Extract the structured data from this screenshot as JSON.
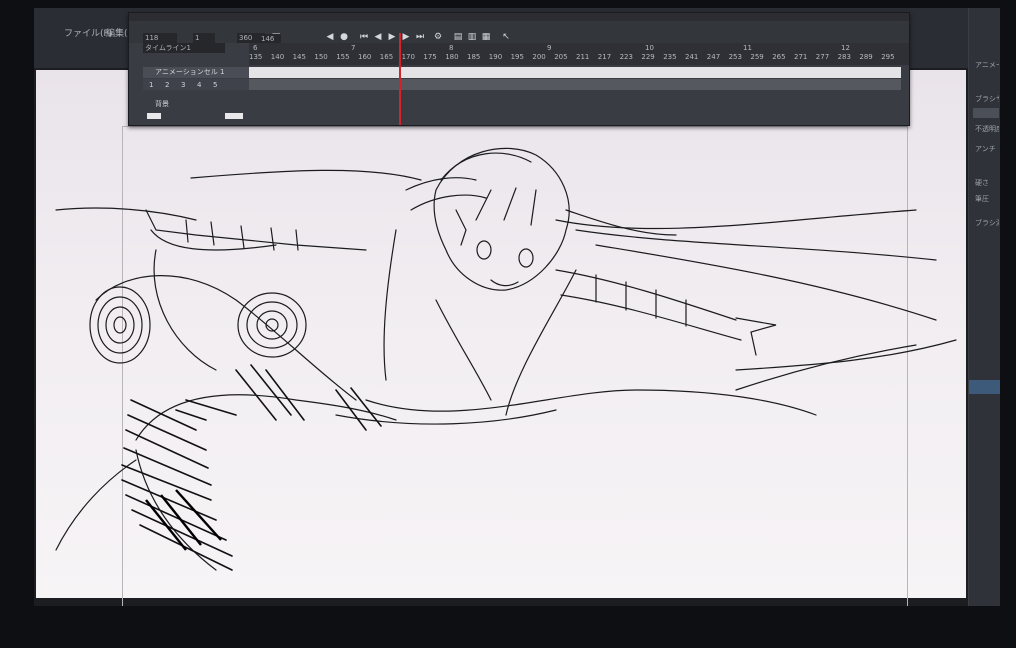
{
  "app": {
    "menu_items": [
      "ファイル(F)",
      "編集(E)"
    ],
    "right_tab": "アニメーション"
  },
  "timeline": {
    "current_frame_field": "118",
    "frame_field_2": "1",
    "frame_field_3": "360",
    "frame_counter": "146",
    "track_name": "タイムライン1",
    "ruler_top": [
      "135",
      "140",
      "145",
      "150",
      "155",
      "160",
      "165",
      "170",
      "175",
      "180",
      "185",
      "190",
      "195",
      "200",
      "205",
      "211",
      "217",
      "223",
      "229",
      "235",
      "241",
      "247",
      "253",
      "259",
      "265",
      "271",
      "277",
      "283",
      "289",
      "295"
    ],
    "ruler_seconds": [
      "6",
      "7",
      "8",
      "9",
      "10",
      "11",
      "12"
    ],
    "layer_name": "アニメーションセル 1",
    "folder_name": "背景",
    "cell_labels": [
      "1",
      "2",
      "3",
      "4",
      "5"
    ]
  },
  "right_panel": {
    "labels": [
      "ブラシサイズ",
      "不透明度",
      "アンチ",
      "硬さ",
      "筆圧",
      "ブラシ濃度"
    ]
  },
  "colors": {
    "screen_bg": "#1b1d21",
    "canvas_paper": "#f1edf1",
    "playhead": "#d5232b",
    "panel_bg": "#393c42"
  }
}
